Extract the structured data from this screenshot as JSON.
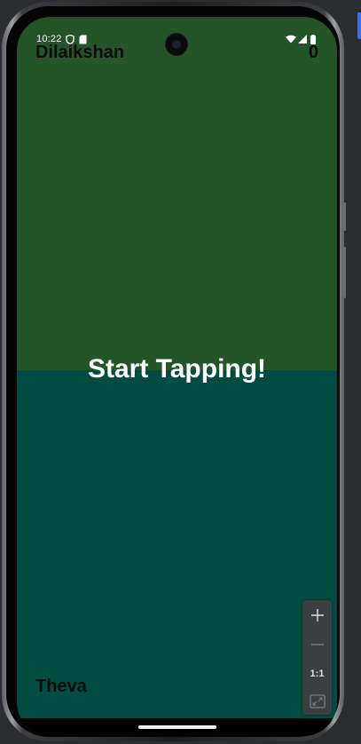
{
  "status_bar": {
    "time": "10:22"
  },
  "game": {
    "top_player": {
      "name": "Dilaikshan",
      "score": "0",
      "color": "#245528"
    },
    "bottom_player": {
      "name": "Theva",
      "color": "#024c44"
    },
    "message": "Start Tapping!"
  },
  "zoom_controls": {
    "zoom_in_icon": "plus-icon",
    "zoom_out_icon": "minus-icon",
    "actual_size_label": "1:1",
    "fit_screen_icon": "fit-screen-icon"
  }
}
